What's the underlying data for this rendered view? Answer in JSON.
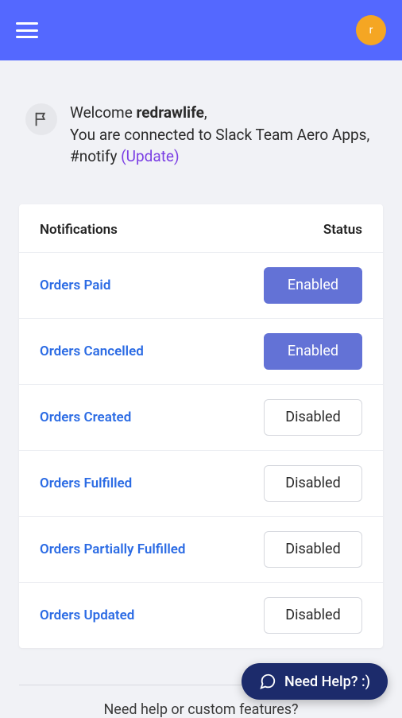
{
  "header": {
    "avatar_initial": "r"
  },
  "welcome": {
    "prefix": "Welcome ",
    "username": "redrawlife",
    "comma": ",",
    "line2": "You are connected to Slack Team Aero Apps, #notify ",
    "update_link": "(Update)"
  },
  "table": {
    "col_notifications": "Notifications",
    "col_status": "Status",
    "rows": [
      {
        "label": "Orders Paid",
        "status": "Enabled",
        "enabled": true
      },
      {
        "label": "Orders Cancelled",
        "status": "Enabled",
        "enabled": true
      },
      {
        "label": "Orders Created",
        "status": "Disabled",
        "enabled": false
      },
      {
        "label": "Orders Fulfilled",
        "status": "Disabled",
        "enabled": false
      },
      {
        "label": "Orders Partially Fulfilled",
        "status": "Disabled",
        "enabled": false
      },
      {
        "label": "Orders Updated",
        "status": "Disabled",
        "enabled": false
      }
    ]
  },
  "footer_text": "Need help or custom features?",
  "help_pill": "Need Help? :)"
}
